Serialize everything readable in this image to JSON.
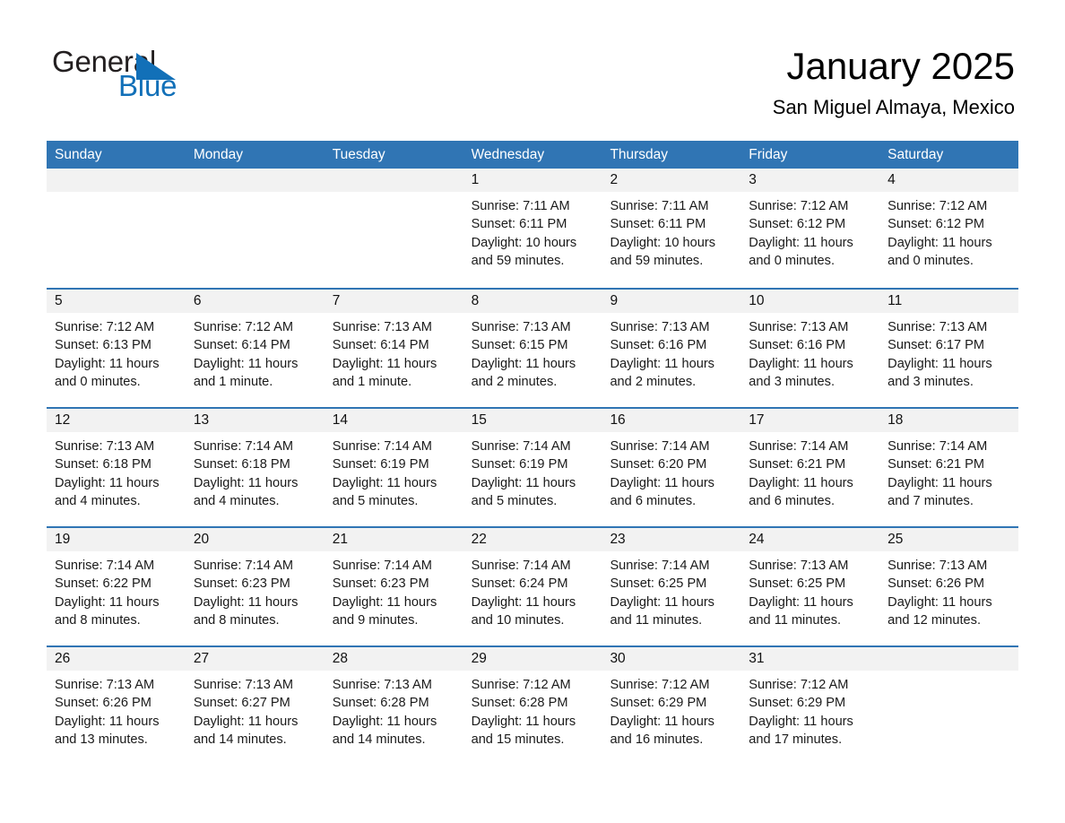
{
  "brand": {
    "name_part1": "General",
    "name_part2": "Blue",
    "triangle_color": "#1270b8",
    "accent_color": "#3075b4"
  },
  "header": {
    "month_title": "January 2025",
    "location": "San Miguel Almaya, Mexico"
  },
  "calendar": {
    "weekdays": [
      "Sunday",
      "Monday",
      "Tuesday",
      "Wednesday",
      "Thursday",
      "Friday",
      "Saturday"
    ],
    "header_bg": "#3075b4",
    "day_band_bg": "#f2f2f2",
    "weeks": [
      [
        {
          "day": "",
          "sunrise": "",
          "sunset": "",
          "daylight1": "",
          "daylight2": ""
        },
        {
          "day": "",
          "sunrise": "",
          "sunset": "",
          "daylight1": "",
          "daylight2": ""
        },
        {
          "day": "",
          "sunrise": "",
          "sunset": "",
          "daylight1": "",
          "daylight2": ""
        },
        {
          "day": "1",
          "sunrise": "Sunrise: 7:11 AM",
          "sunset": "Sunset: 6:11 PM",
          "daylight1": "Daylight: 10 hours",
          "daylight2": "and 59 minutes."
        },
        {
          "day": "2",
          "sunrise": "Sunrise: 7:11 AM",
          "sunset": "Sunset: 6:11 PM",
          "daylight1": "Daylight: 10 hours",
          "daylight2": "and 59 minutes."
        },
        {
          "day": "3",
          "sunrise": "Sunrise: 7:12 AM",
          "sunset": "Sunset: 6:12 PM",
          "daylight1": "Daylight: 11 hours",
          "daylight2": "and 0 minutes."
        },
        {
          "day": "4",
          "sunrise": "Sunrise: 7:12 AM",
          "sunset": "Sunset: 6:12 PM",
          "daylight1": "Daylight: 11 hours",
          "daylight2": "and 0 minutes."
        }
      ],
      [
        {
          "day": "5",
          "sunrise": "Sunrise: 7:12 AM",
          "sunset": "Sunset: 6:13 PM",
          "daylight1": "Daylight: 11 hours",
          "daylight2": "and 0 minutes."
        },
        {
          "day": "6",
          "sunrise": "Sunrise: 7:12 AM",
          "sunset": "Sunset: 6:14 PM",
          "daylight1": "Daylight: 11 hours",
          "daylight2": "and 1 minute."
        },
        {
          "day": "7",
          "sunrise": "Sunrise: 7:13 AM",
          "sunset": "Sunset: 6:14 PM",
          "daylight1": "Daylight: 11 hours",
          "daylight2": "and 1 minute."
        },
        {
          "day": "8",
          "sunrise": "Sunrise: 7:13 AM",
          "sunset": "Sunset: 6:15 PM",
          "daylight1": "Daylight: 11 hours",
          "daylight2": "and 2 minutes."
        },
        {
          "day": "9",
          "sunrise": "Sunrise: 7:13 AM",
          "sunset": "Sunset: 6:16 PM",
          "daylight1": "Daylight: 11 hours",
          "daylight2": "and 2 minutes."
        },
        {
          "day": "10",
          "sunrise": "Sunrise: 7:13 AM",
          "sunset": "Sunset: 6:16 PM",
          "daylight1": "Daylight: 11 hours",
          "daylight2": "and 3 minutes."
        },
        {
          "day": "11",
          "sunrise": "Sunrise: 7:13 AM",
          "sunset": "Sunset: 6:17 PM",
          "daylight1": "Daylight: 11 hours",
          "daylight2": "and 3 minutes."
        }
      ],
      [
        {
          "day": "12",
          "sunrise": "Sunrise: 7:13 AM",
          "sunset": "Sunset: 6:18 PM",
          "daylight1": "Daylight: 11 hours",
          "daylight2": "and 4 minutes."
        },
        {
          "day": "13",
          "sunrise": "Sunrise: 7:14 AM",
          "sunset": "Sunset: 6:18 PM",
          "daylight1": "Daylight: 11 hours",
          "daylight2": "and 4 minutes."
        },
        {
          "day": "14",
          "sunrise": "Sunrise: 7:14 AM",
          "sunset": "Sunset: 6:19 PM",
          "daylight1": "Daylight: 11 hours",
          "daylight2": "and 5 minutes."
        },
        {
          "day": "15",
          "sunrise": "Sunrise: 7:14 AM",
          "sunset": "Sunset: 6:19 PM",
          "daylight1": "Daylight: 11 hours",
          "daylight2": "and 5 minutes."
        },
        {
          "day": "16",
          "sunrise": "Sunrise: 7:14 AM",
          "sunset": "Sunset: 6:20 PM",
          "daylight1": "Daylight: 11 hours",
          "daylight2": "and 6 minutes."
        },
        {
          "day": "17",
          "sunrise": "Sunrise: 7:14 AM",
          "sunset": "Sunset: 6:21 PM",
          "daylight1": "Daylight: 11 hours",
          "daylight2": "and 6 minutes."
        },
        {
          "day": "18",
          "sunrise": "Sunrise: 7:14 AM",
          "sunset": "Sunset: 6:21 PM",
          "daylight1": "Daylight: 11 hours",
          "daylight2": "and 7 minutes."
        }
      ],
      [
        {
          "day": "19",
          "sunrise": "Sunrise: 7:14 AM",
          "sunset": "Sunset: 6:22 PM",
          "daylight1": "Daylight: 11 hours",
          "daylight2": "and 8 minutes."
        },
        {
          "day": "20",
          "sunrise": "Sunrise: 7:14 AM",
          "sunset": "Sunset: 6:23 PM",
          "daylight1": "Daylight: 11 hours",
          "daylight2": "and 8 minutes."
        },
        {
          "day": "21",
          "sunrise": "Sunrise: 7:14 AM",
          "sunset": "Sunset: 6:23 PM",
          "daylight1": "Daylight: 11 hours",
          "daylight2": "and 9 minutes."
        },
        {
          "day": "22",
          "sunrise": "Sunrise: 7:14 AM",
          "sunset": "Sunset: 6:24 PM",
          "daylight1": "Daylight: 11 hours",
          "daylight2": "and 10 minutes."
        },
        {
          "day": "23",
          "sunrise": "Sunrise: 7:14 AM",
          "sunset": "Sunset: 6:25 PM",
          "daylight1": "Daylight: 11 hours",
          "daylight2": "and 11 minutes."
        },
        {
          "day": "24",
          "sunrise": "Sunrise: 7:13 AM",
          "sunset": "Sunset: 6:25 PM",
          "daylight1": "Daylight: 11 hours",
          "daylight2": "and 11 minutes."
        },
        {
          "day": "25",
          "sunrise": "Sunrise: 7:13 AM",
          "sunset": "Sunset: 6:26 PM",
          "daylight1": "Daylight: 11 hours",
          "daylight2": "and 12 minutes."
        }
      ],
      [
        {
          "day": "26",
          "sunrise": "Sunrise: 7:13 AM",
          "sunset": "Sunset: 6:26 PM",
          "daylight1": "Daylight: 11 hours",
          "daylight2": "and 13 minutes."
        },
        {
          "day": "27",
          "sunrise": "Sunrise: 7:13 AM",
          "sunset": "Sunset: 6:27 PM",
          "daylight1": "Daylight: 11 hours",
          "daylight2": "and 14 minutes."
        },
        {
          "day": "28",
          "sunrise": "Sunrise: 7:13 AM",
          "sunset": "Sunset: 6:28 PM",
          "daylight1": "Daylight: 11 hours",
          "daylight2": "and 14 minutes."
        },
        {
          "day": "29",
          "sunrise": "Sunrise: 7:12 AM",
          "sunset": "Sunset: 6:28 PM",
          "daylight1": "Daylight: 11 hours",
          "daylight2": "and 15 minutes."
        },
        {
          "day": "30",
          "sunrise": "Sunrise: 7:12 AM",
          "sunset": "Sunset: 6:29 PM",
          "daylight1": "Daylight: 11 hours",
          "daylight2": "and 16 minutes."
        },
        {
          "day": "31",
          "sunrise": "Sunrise: 7:12 AM",
          "sunset": "Sunset: 6:29 PM",
          "daylight1": "Daylight: 11 hours",
          "daylight2": "and 17 minutes."
        },
        {
          "day": "",
          "sunrise": "",
          "sunset": "",
          "daylight1": "",
          "daylight2": ""
        }
      ]
    ]
  }
}
